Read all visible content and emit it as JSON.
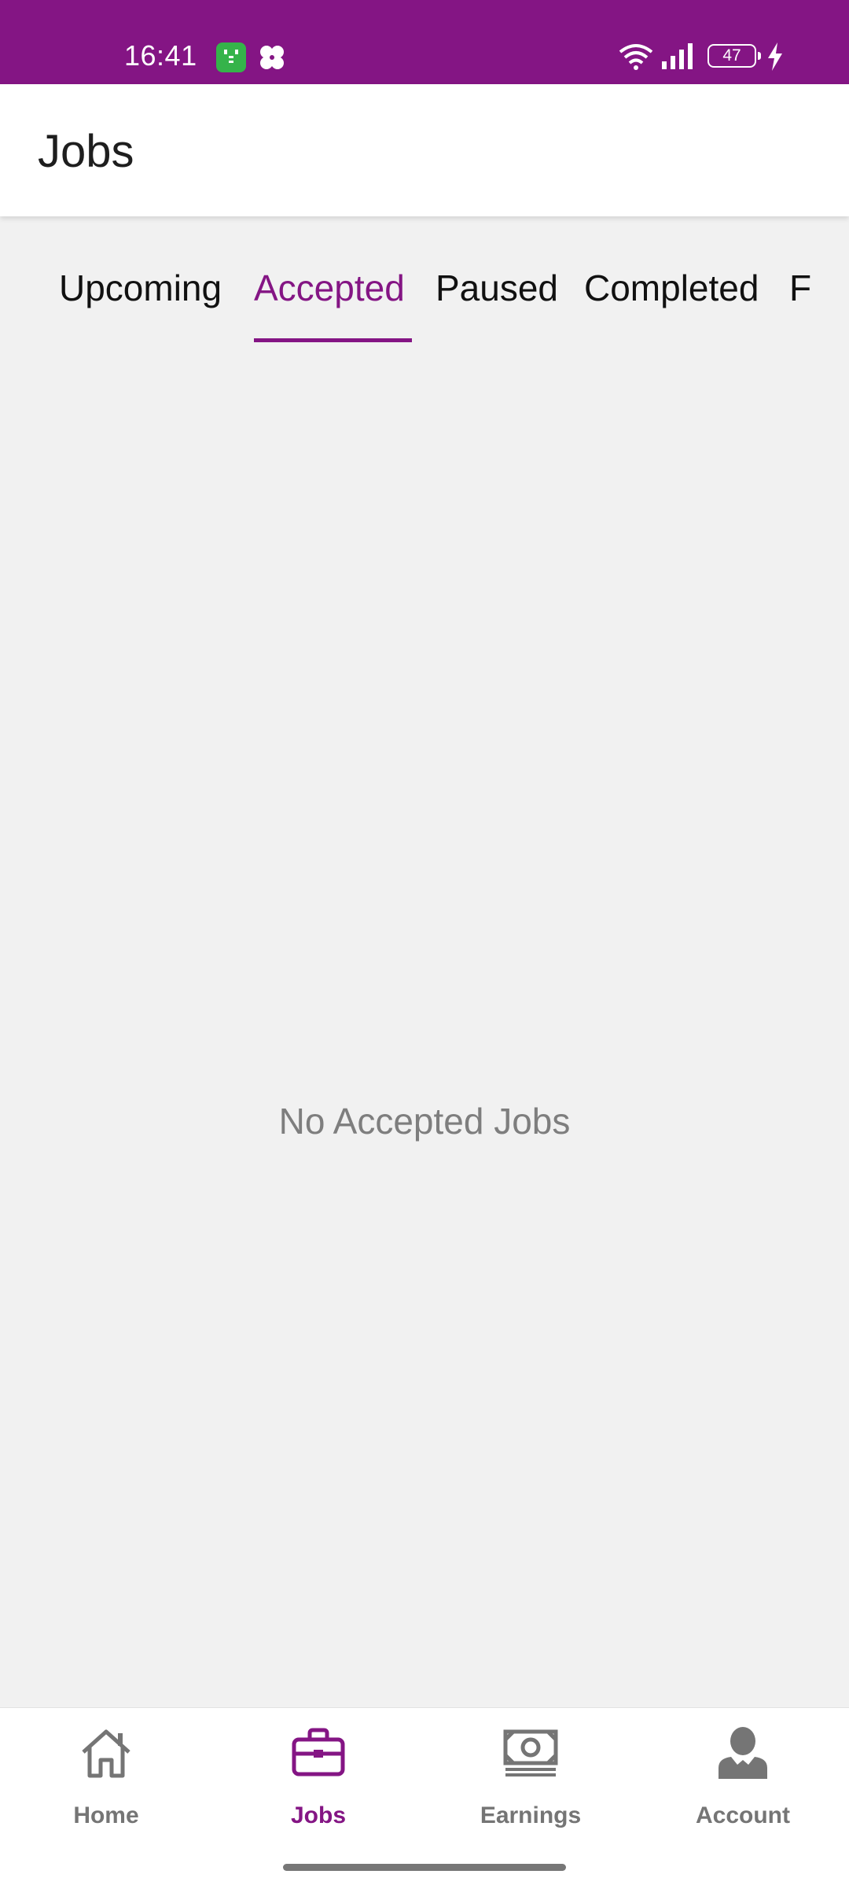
{
  "status_bar": {
    "time": "16:41",
    "battery_level": "47",
    "icons": [
      "app-notification-icon",
      "clover-icon",
      "wifi-icon",
      "signal-icon",
      "battery-icon",
      "charging-bolt-icon"
    ]
  },
  "app_bar": {
    "title": "Jobs"
  },
  "tabs": [
    {
      "label": "Upcoming",
      "active": false
    },
    {
      "label": "Accepted",
      "active": true
    },
    {
      "label": "Paused",
      "active": false
    },
    {
      "label": "Completed",
      "active": false
    },
    {
      "label": "F",
      "active": false
    }
  ],
  "empty_state": {
    "message": "No Accepted Jobs"
  },
  "bottom_nav": [
    {
      "label": "Home",
      "icon": "home-icon",
      "active": false
    },
    {
      "label": "Jobs",
      "icon": "briefcase-icon",
      "active": true
    },
    {
      "label": "Earnings",
      "icon": "cash-icon",
      "active": false
    },
    {
      "label": "Account",
      "icon": "person-icon",
      "active": false
    }
  ],
  "colors": {
    "brand": "#841584",
    "background": "#f1f1f1",
    "inactive": "#757575"
  }
}
